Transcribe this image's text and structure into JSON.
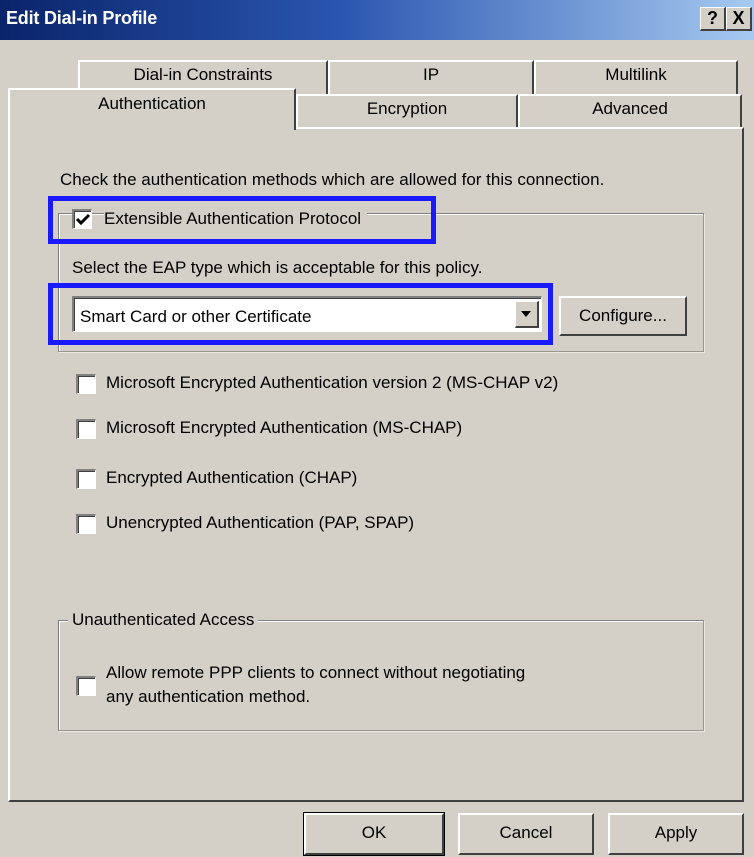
{
  "window": {
    "title": "Edit Dial-in Profile",
    "help_button": "?",
    "close_button": "X"
  },
  "tabs": {
    "row_back": [
      "Dial-in Constraints",
      "IP",
      "Multilink"
    ],
    "row_front": [
      "Authentication",
      "Encryption",
      "Advanced"
    ],
    "active": "Authentication"
  },
  "panel": {
    "instructions": "Check the authentication methods which are allowed for this connection.",
    "eap": {
      "label": "Extensible Authentication Protocol",
      "checked": true,
      "select_prompt": "Select the EAP type which is acceptable for this policy.",
      "selected_type": "Smart Card or other Certificate",
      "configure_label": "Configure..."
    },
    "methods": [
      {
        "label": "Microsoft Encrypted Authentication version 2 (MS-CHAP v2)",
        "checked": false
      },
      {
        "label": "Microsoft Encrypted Authentication (MS-CHAP)",
        "checked": false
      },
      {
        "label": "Encrypted Authentication (CHAP)",
        "checked": false
      },
      {
        "label": "Unencrypted Authentication (PAP, SPAP)",
        "checked": false
      }
    ],
    "unauth": {
      "legend": "Unauthenticated Access",
      "line1": "Allow remote PPP clients to connect without negotiating",
      "line2": "any authentication method.",
      "checked": false
    }
  },
  "buttons": {
    "ok": "OK",
    "cancel": "Cancel",
    "apply": "Apply"
  },
  "colors": {
    "highlight": "#1a1aff",
    "titlebar_start": "#0a246a",
    "titlebar_end": "#a6caf0",
    "face": "#d4d0c8"
  }
}
